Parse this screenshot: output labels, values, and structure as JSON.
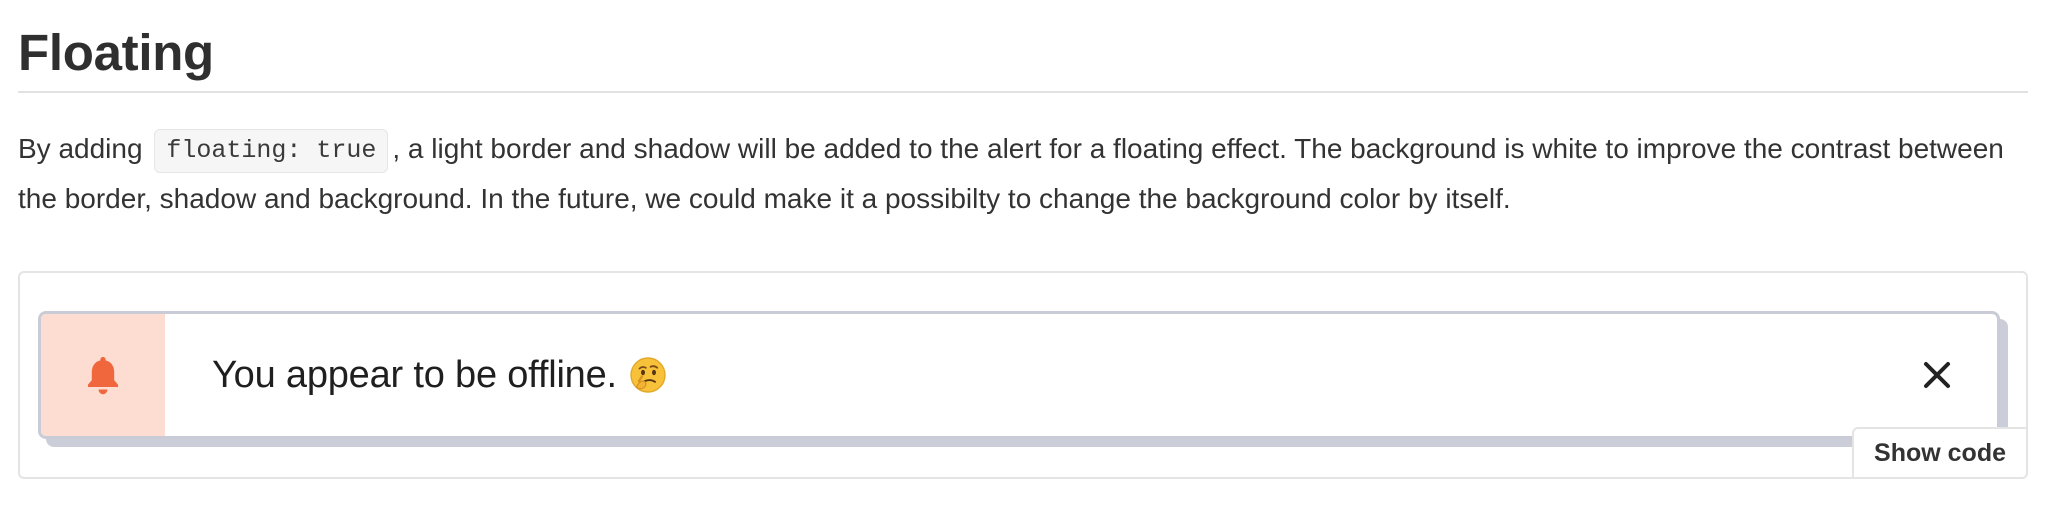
{
  "section": {
    "title": "Floating"
  },
  "intro": {
    "before_code": "By adding ",
    "code": "floating: true",
    "after_code": ", a light border and shadow will be added to the alert for a floating effect. The background is white to improve the contrast between the border, shadow and background. In the future, we could make it a possibilty to change the background color by itself."
  },
  "alert": {
    "message": "You appear to be offline.",
    "emoji": "thinking-face-emoji",
    "icon": "bell-icon",
    "close_icon": "close-icon",
    "accent_color": "#f0673e",
    "icon_bg_color": "#fddcd2",
    "border_color": "#c9ccd7"
  },
  "example": {
    "show_code_label": "Show code"
  }
}
